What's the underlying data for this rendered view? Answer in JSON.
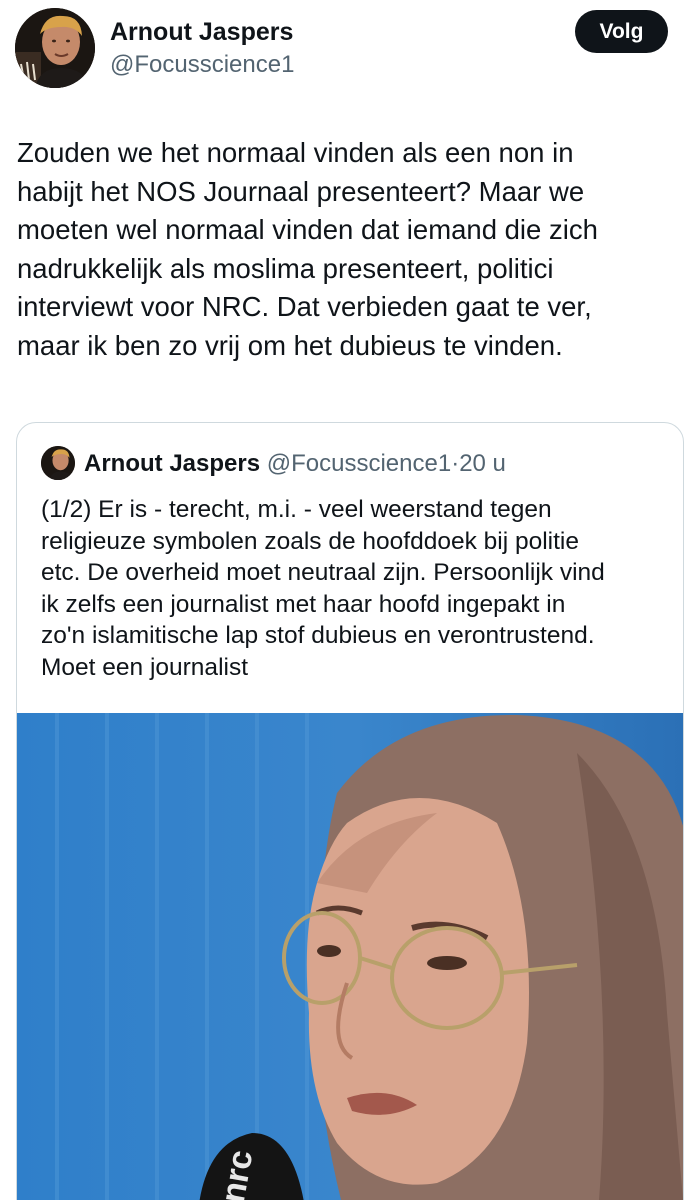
{
  "author": {
    "name": "Arnout Jaspers",
    "handle": "@Focusscience1"
  },
  "follow_label": "Volg",
  "tweet": {
    "lines": [
      "Zouden we het normaal vinden als een non in",
      "habijt het NOS Journaal presenteert? Maar we",
      "moeten wel normaal vinden dat iemand die zich",
      "nadrukkelijk als moslima presenteert, politici",
      "interviewt voor NRC. Dat verbieden gaat te ver,",
      "maar ik ben zo vrij om  het dubieus te vinden."
    ]
  },
  "quoted": {
    "name": "Arnout Jaspers",
    "handle": "@Focusscience1",
    "separator": "·",
    "time": "20 u",
    "lines": [
      "(1/2) Er is - terecht, m.i. - veel weerstand tegen",
      "religieuze symbolen zoals de hoofddoek bij politie",
      "etc. De overheid moet neutraal zijn. Persoonlijk vind",
      "ik zelfs een journalist met haar hoofd ingepakt in",
      "zo'n islamitische lap stof dubieus en verontrustend.",
      "Moet een journalist"
    ],
    "media": {
      "kind": "photo",
      "subject": "woman-with-headscarf-and-glasses-at-microphone",
      "colors": {
        "background": "#2a78c4",
        "scarf": "#8d6f63",
        "skin": "#d9a58e"
      }
    }
  }
}
